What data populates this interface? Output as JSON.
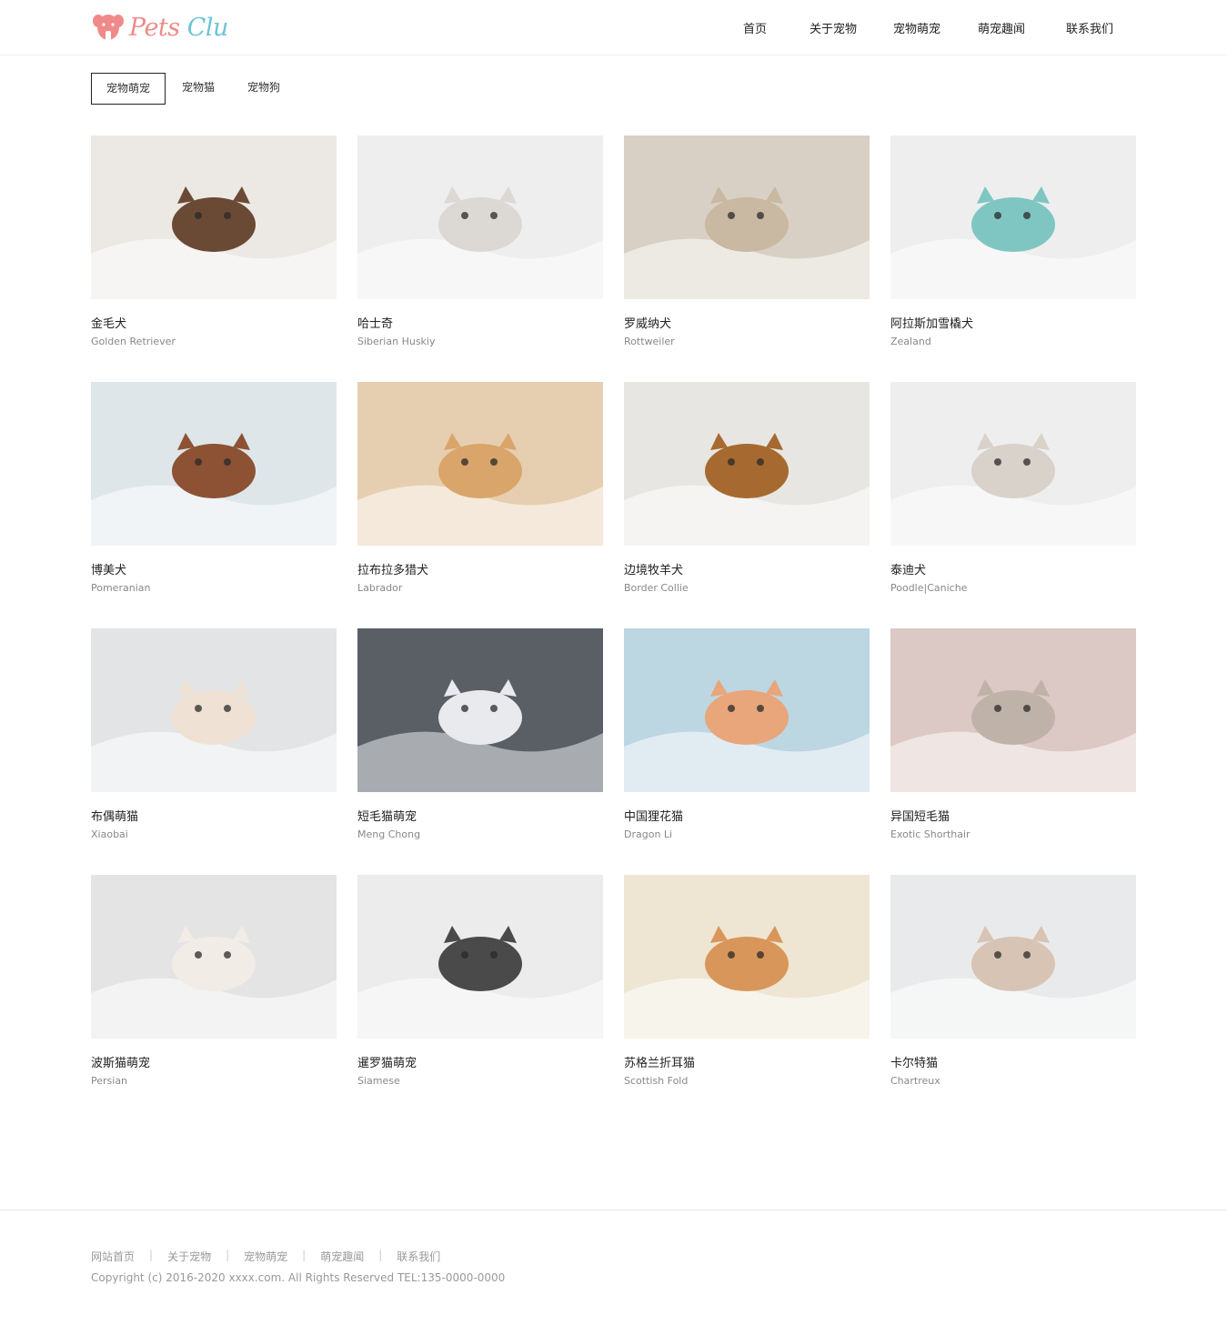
{
  "brand": {
    "logo_text_a": "Pets",
    "logo_text_b": "Clu",
    "colors": {
      "pink": "#f08a8a",
      "teal": "#6cc4d6"
    }
  },
  "nav": [
    "首页",
    "关于宠物",
    "宠物萌宠",
    "萌宠趣闻",
    "联系我们"
  ],
  "tabs": [
    {
      "label": "宠物萌宠",
      "active": true
    },
    {
      "label": "宠物猫",
      "active": false
    },
    {
      "label": "宠物狗",
      "active": false
    }
  ],
  "pets": [
    {
      "name": "金毛犬",
      "en": "Golden Retriever",
      "bg": "#ece9e4",
      "accent": "#6b4a35"
    },
    {
      "name": "哈士奇",
      "en": "Siberian Huskiy",
      "bg": "#eeeeee",
      "accent": "#dcd8d4"
    },
    {
      "name": "罗威纳犬",
      "en": "Rottweiler",
      "bg": "#d8d0c4",
      "accent": "#c9b8a2"
    },
    {
      "name": "阿拉斯加雪橇犬",
      "en": "Zealand",
      "bg": "#eeeeee",
      "accent": "#7fc6c2"
    },
    {
      "name": "博美犬",
      "en": "Pomeranian",
      "bg": "#dfe6ea",
      "accent": "#8d5234"
    },
    {
      "name": "拉布拉多猎犬",
      "en": "Labrador",
      "bg": "#e6cfb0",
      "accent": "#d9a56a"
    },
    {
      "name": "边境牧羊犬",
      "en": "Border Collie",
      "bg": "#e8e6e2",
      "accent": "#a6692f"
    },
    {
      "name": "泰迪犬",
      "en": "Poodle|Caniche",
      "bg": "#eeeeee",
      "accent": "#d8d2ca"
    },
    {
      "name": "布偶萌猫",
      "en": "Xiaobai",
      "bg": "#e2e4e6",
      "accent": "#efe2d4"
    },
    {
      "name": "短毛猫萌宠",
      "en": "Meng Chong",
      "bg": "#5a5f66",
      "accent": "#e8eaee"
    },
    {
      "name": "中国狸花猫",
      "en": "Dragon Li",
      "bg": "#bcd6e2",
      "accent": "#e8a67a"
    },
    {
      "name": "异国短毛猫",
      "en": "Exotic Shorthair",
      "bg": "#dcc8c4",
      "accent": "#bfb2a8"
    },
    {
      "name": "波斯猫萌宠",
      "en": "Persian",
      "bg": "#e4e4e4",
      "accent": "#f2ece6"
    },
    {
      "name": "暹罗猫萌宠",
      "en": "Siamese",
      "bg": "#ececec",
      "accent": "#4a4a4a"
    },
    {
      "name": "苏格兰折耳猫",
      "en": "Scottish Fold",
      "bg": "#eee6d2",
      "accent": "#d9965a"
    },
    {
      "name": "卡尔特猫",
      "en": "Chartreux",
      "bg": "#e9eaec",
      "accent": "#d8c4b4"
    }
  ],
  "footer": {
    "links": [
      "网站首页",
      "关于宠物",
      "宠物萌宠",
      "萌宠趣闻",
      "联系我们"
    ],
    "copyright": "Copyright (c) 2016-2020 xxxx.com. All Rights Reserved TEL:135-0000-0000"
  }
}
